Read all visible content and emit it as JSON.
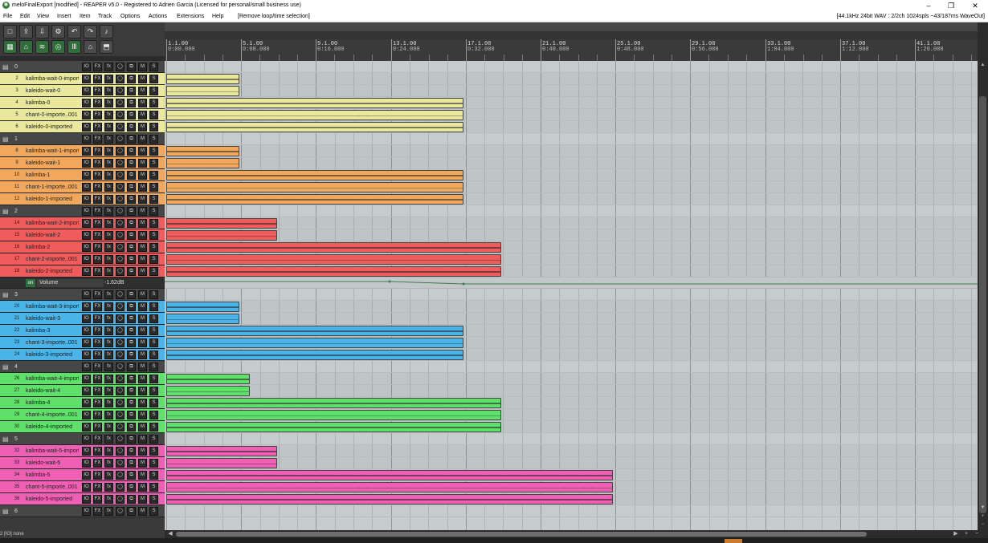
{
  "window": {
    "title": "meloFinalExport [modified] - REAPER v5.0 - Registered to Adrien Garcia (Licensed for personal/small business use)",
    "minimize": "–",
    "restore": "❐",
    "close": "✕"
  },
  "menu": {
    "items": [
      "File",
      "Edit",
      "View",
      "Insert",
      "Item",
      "Track",
      "Options",
      "Actions",
      "Extensions",
      "Help",
      "[Remove loop/time selection]"
    ],
    "status": "[44.1kHz 24bit WAV : 2/2ch 1024spls ~43/187ms WaveOut]"
  },
  "toolbar": {
    "row1": [
      "new-project-icon",
      "open-project-icon",
      "save-project-icon",
      "settings-icon",
      "undo-icon",
      "redo-icon",
      "metronome-icon"
    ],
    "row2": [
      "grid-icon",
      "snap-icon",
      "ripple-icon",
      "glue-icon",
      "envelope-icon",
      "lock-icon",
      "loop-icon"
    ]
  },
  "ruler": {
    "markers": [
      {
        "bar": "1.1.00",
        "time": "0:00.000"
      },
      {
        "bar": "5.1.00",
        "time": "0:08.000"
      },
      {
        "bar": "9.1.00",
        "time": "0:16.000"
      },
      {
        "bar": "13.1.00",
        "time": "0:24.000"
      },
      {
        "bar": "17.1.00",
        "time": "0:32.000"
      },
      {
        "bar": "21.1.00",
        "time": "0:40.000"
      },
      {
        "bar": "25.1.00",
        "time": "0:48.000"
      },
      {
        "bar": "29.1.00",
        "time": "0:56.000"
      },
      {
        "bar": "33.1.00",
        "time": "1:04.000"
      },
      {
        "bar": "37.1.00",
        "time": "1:12.000"
      },
      {
        "bar": "41.1.00",
        "time": "1:20.000"
      }
    ]
  },
  "track_buttons": [
    "IO",
    "FX",
    "fx",
    "◯",
    "⧉",
    "M",
    "S"
  ],
  "tracks": [
    {
      "num": "1",
      "name": "0",
      "folder": true,
      "color": "#c9c9a5"
    },
    {
      "num": "2",
      "name": "kalimba-wait-0-import",
      "color": "#e9e89c"
    },
    {
      "num": "3",
      "name": "kaleido-wait-0",
      "color": "#e9e89c"
    },
    {
      "num": "4",
      "name": "kalimba-0",
      "color": "#e9e89c"
    },
    {
      "num": "5",
      "name": "chant-0-importe..001",
      "color": "#e9e89c"
    },
    {
      "num": "6",
      "name": "kaleido-0-imported",
      "color": "#e9e89c"
    },
    {
      "num": "7",
      "name": "1",
      "folder": true,
      "color": "#d6a77a"
    },
    {
      "num": "8",
      "name": "kalimba-wait-1-import",
      "color": "#f1a85c"
    },
    {
      "num": "9",
      "name": "kaleido-wait-1",
      "color": "#f1a85c"
    },
    {
      "num": "10",
      "name": "kalimba-1",
      "color": "#f1a85c"
    },
    {
      "num": "11",
      "name": "chant-1-importe..001",
      "color": "#f1a85c"
    },
    {
      "num": "12",
      "name": "kaleido-1-imported",
      "color": "#f1a85c"
    },
    {
      "num": "13",
      "name": "2",
      "folder": true,
      "color": "#d88888"
    },
    {
      "num": "14",
      "name": "kalimba-wait-2-import",
      "color": "#f05b5b"
    },
    {
      "num": "15",
      "name": "kaleido-wait-2",
      "color": "#f05b5b"
    },
    {
      "num": "16",
      "name": "kalimba-2",
      "color": "#f05b5b"
    },
    {
      "num": "17",
      "name": "chant-2-importe..001",
      "color": "#f05b5b"
    },
    {
      "num": "18",
      "name": "kaleido-2-imported",
      "color": "#f05b5b"
    },
    {
      "env": true,
      "name": "Volume",
      "value": "-1.62dB"
    },
    {
      "num": "19",
      "name": "3",
      "folder": true,
      "color": "#9ab5c7"
    },
    {
      "num": "20",
      "name": "kalimba-wait-3-import",
      "color": "#4ab3e8"
    },
    {
      "num": "21",
      "name": "kaleido-wait-3",
      "color": "#4ab3e8"
    },
    {
      "num": "22",
      "name": "kalimba-3",
      "color": "#4ab3e8"
    },
    {
      "num": "23",
      "name": "chant-3-importe..001",
      "color": "#4ab3e8"
    },
    {
      "num": "24",
      "name": "kaleido-3-imported",
      "color": "#4ab3e8"
    },
    {
      "num": "25",
      "name": "4",
      "folder": true,
      "color": "#96c79b"
    },
    {
      "num": "26",
      "name": "kalimba-wait-4-import",
      "color": "#5ee06a"
    },
    {
      "num": "27",
      "name": "kaleido-wait-4",
      "color": "#5ee06a"
    },
    {
      "num": "28",
      "name": "kalimba-4",
      "color": "#5ee06a"
    },
    {
      "num": "29",
      "name": "chant-4-importe..001",
      "color": "#5ee06a"
    },
    {
      "num": "30",
      "name": "kaleido-4-imported",
      "color": "#5ee06a"
    },
    {
      "num": "31",
      "name": "5",
      "folder": true,
      "color": "#c9a0b9"
    },
    {
      "num": "32",
      "name": "kalimba-wait-5-import",
      "color": "#ef5fb3"
    },
    {
      "num": "33",
      "name": "kaleido-wait-5",
      "color": "#ef5fb3"
    },
    {
      "num": "34",
      "name": "kalimba-5",
      "color": "#ef5fb3"
    },
    {
      "num": "35",
      "name": "chant-5-importe..001",
      "color": "#ef5fb3"
    },
    {
      "num": "36",
      "name": "kaleido-5-imported",
      "color": "#ef5fb3"
    },
    {
      "num": "37",
      "name": "6",
      "folder": true,
      "color": "#b8b8b8"
    }
  ],
  "statusbar": {
    "text": "2 [IO] none"
  }
}
